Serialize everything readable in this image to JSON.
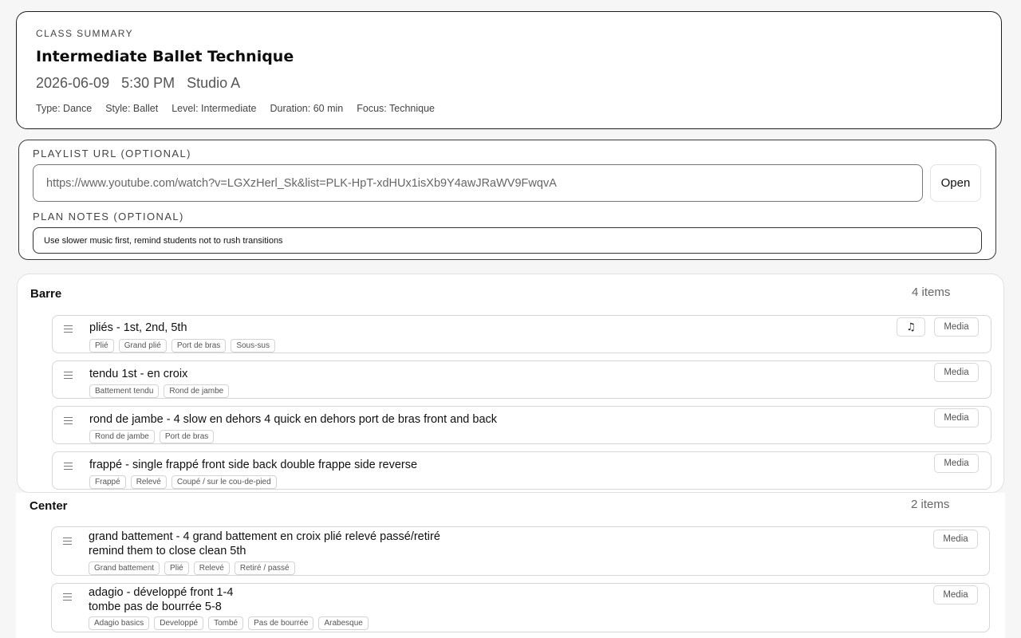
{
  "summary": {
    "eyebrow": "CLASS SUMMARY",
    "title": "Intermediate Ballet Technique",
    "when": "2026-06-09   5:30 PM   Studio A",
    "meta": [
      "Type: Dance",
      "Style: Ballet",
      "Level: Intermediate",
      "Duration: 60 min",
      "Focus: Technique"
    ]
  },
  "plan": {
    "playlist_label": "PLAYLIST URL (OPTIONAL)",
    "playlist_value": "https://www.youtube.com/watch?v=LGXzHerl_Sk&list=PLK-HpT-xdHUx1isXb9Y4awJRaWV9FwqvA",
    "open_label": "Open",
    "notes_label": "PLAN NOTES (OPTIONAL)",
    "notes_value": "Use slower music first, remind students not to rush transitions"
  },
  "barre": {
    "title": "Barre",
    "count": "4 items",
    "items": [
      {
        "title": "pliés - 1st, 2nd, 5th",
        "tags": [
          "Plié",
          "Grand plié",
          "Port de bras",
          "Sous-sus"
        ],
        "media": "Media",
        "music_icon": "music-note-icon"
      },
      {
        "title": "tendu 1st - en croix",
        "tags": [
          "Battement tendu",
          "Rond de jambe"
        ],
        "media": "Media"
      },
      {
        "title": "rond de jambe - 4 slow en dehors 4 quick en dehors port de bras front and back",
        "tags": [
          "Rond de jambe",
          "Port de bras"
        ],
        "media": "Media"
      },
      {
        "title": "frappé - single frappé front side back double frappe side reverse",
        "tags": [
          "Frappé",
          "Relevé",
          "Coupé / sur le cou-de-pied"
        ],
        "media": "Media"
      }
    ]
  },
  "center": {
    "title": "Center",
    "count": "2 items",
    "items": [
      {
        "title": "grand battement - 4 grand battement en croix plié relevé passé/retiré",
        "title2": "remind them to close clean 5th",
        "tags": [
          "Grand battement",
          "Plié",
          "Relevé",
          "Retiré / passé"
        ],
        "media": "Media"
      },
      {
        "title": "adagio - développé front 1-4",
        "title2": "tombe pas de bourrée 5-8",
        "tags": [
          "Adagio basics",
          "Developpé",
          "Tombé",
          "Pas de bourrée",
          "Arabesque"
        ],
        "media": "Media"
      }
    ]
  }
}
